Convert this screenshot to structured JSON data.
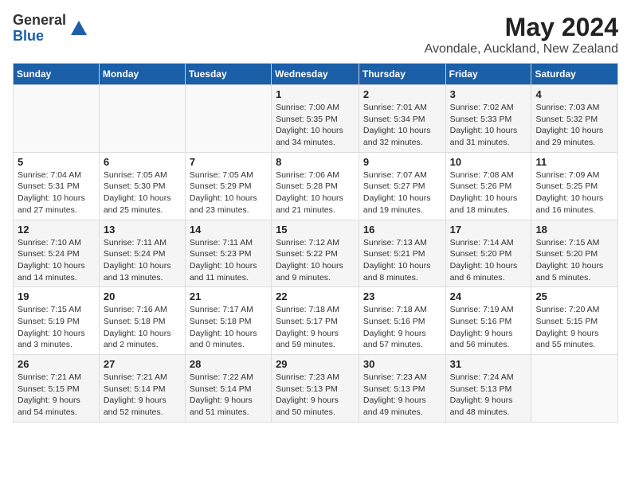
{
  "header": {
    "logo_general": "General",
    "logo_blue": "Blue",
    "month_year": "May 2024",
    "location": "Avondale, Auckland, New Zealand"
  },
  "days_of_week": [
    "Sunday",
    "Monday",
    "Tuesday",
    "Wednesday",
    "Thursday",
    "Friday",
    "Saturday"
  ],
  "weeks": [
    [
      {
        "day": "",
        "info": ""
      },
      {
        "day": "",
        "info": ""
      },
      {
        "day": "",
        "info": ""
      },
      {
        "day": "1",
        "info": "Sunrise: 7:00 AM\nSunset: 5:35 PM\nDaylight: 10 hours\nand 34 minutes."
      },
      {
        "day": "2",
        "info": "Sunrise: 7:01 AM\nSunset: 5:34 PM\nDaylight: 10 hours\nand 32 minutes."
      },
      {
        "day": "3",
        "info": "Sunrise: 7:02 AM\nSunset: 5:33 PM\nDaylight: 10 hours\nand 31 minutes."
      },
      {
        "day": "4",
        "info": "Sunrise: 7:03 AM\nSunset: 5:32 PM\nDaylight: 10 hours\nand 29 minutes."
      }
    ],
    [
      {
        "day": "5",
        "info": "Sunrise: 7:04 AM\nSunset: 5:31 PM\nDaylight: 10 hours\nand 27 minutes."
      },
      {
        "day": "6",
        "info": "Sunrise: 7:05 AM\nSunset: 5:30 PM\nDaylight: 10 hours\nand 25 minutes."
      },
      {
        "day": "7",
        "info": "Sunrise: 7:05 AM\nSunset: 5:29 PM\nDaylight: 10 hours\nand 23 minutes."
      },
      {
        "day": "8",
        "info": "Sunrise: 7:06 AM\nSunset: 5:28 PM\nDaylight: 10 hours\nand 21 minutes."
      },
      {
        "day": "9",
        "info": "Sunrise: 7:07 AM\nSunset: 5:27 PM\nDaylight: 10 hours\nand 19 minutes."
      },
      {
        "day": "10",
        "info": "Sunrise: 7:08 AM\nSunset: 5:26 PM\nDaylight: 10 hours\nand 18 minutes."
      },
      {
        "day": "11",
        "info": "Sunrise: 7:09 AM\nSunset: 5:25 PM\nDaylight: 10 hours\nand 16 minutes."
      }
    ],
    [
      {
        "day": "12",
        "info": "Sunrise: 7:10 AM\nSunset: 5:24 PM\nDaylight: 10 hours\nand 14 minutes."
      },
      {
        "day": "13",
        "info": "Sunrise: 7:11 AM\nSunset: 5:24 PM\nDaylight: 10 hours\nand 13 minutes."
      },
      {
        "day": "14",
        "info": "Sunrise: 7:11 AM\nSunset: 5:23 PM\nDaylight: 10 hours\nand 11 minutes."
      },
      {
        "day": "15",
        "info": "Sunrise: 7:12 AM\nSunset: 5:22 PM\nDaylight: 10 hours\nand 9 minutes."
      },
      {
        "day": "16",
        "info": "Sunrise: 7:13 AM\nSunset: 5:21 PM\nDaylight: 10 hours\nand 8 minutes."
      },
      {
        "day": "17",
        "info": "Sunrise: 7:14 AM\nSunset: 5:20 PM\nDaylight: 10 hours\nand 6 minutes."
      },
      {
        "day": "18",
        "info": "Sunrise: 7:15 AM\nSunset: 5:20 PM\nDaylight: 10 hours\nand 5 minutes."
      }
    ],
    [
      {
        "day": "19",
        "info": "Sunrise: 7:15 AM\nSunset: 5:19 PM\nDaylight: 10 hours\nand 3 minutes."
      },
      {
        "day": "20",
        "info": "Sunrise: 7:16 AM\nSunset: 5:18 PM\nDaylight: 10 hours\nand 2 minutes."
      },
      {
        "day": "21",
        "info": "Sunrise: 7:17 AM\nSunset: 5:18 PM\nDaylight: 10 hours\nand 0 minutes."
      },
      {
        "day": "22",
        "info": "Sunrise: 7:18 AM\nSunset: 5:17 PM\nDaylight: 9 hours\nand 59 minutes."
      },
      {
        "day": "23",
        "info": "Sunrise: 7:18 AM\nSunset: 5:16 PM\nDaylight: 9 hours\nand 57 minutes."
      },
      {
        "day": "24",
        "info": "Sunrise: 7:19 AM\nSunset: 5:16 PM\nDaylight: 9 hours\nand 56 minutes."
      },
      {
        "day": "25",
        "info": "Sunrise: 7:20 AM\nSunset: 5:15 PM\nDaylight: 9 hours\nand 55 minutes."
      }
    ],
    [
      {
        "day": "26",
        "info": "Sunrise: 7:21 AM\nSunset: 5:15 PM\nDaylight: 9 hours\nand 54 minutes."
      },
      {
        "day": "27",
        "info": "Sunrise: 7:21 AM\nSunset: 5:14 PM\nDaylight: 9 hours\nand 52 minutes."
      },
      {
        "day": "28",
        "info": "Sunrise: 7:22 AM\nSunset: 5:14 PM\nDaylight: 9 hours\nand 51 minutes."
      },
      {
        "day": "29",
        "info": "Sunrise: 7:23 AM\nSunset: 5:13 PM\nDaylight: 9 hours\nand 50 minutes."
      },
      {
        "day": "30",
        "info": "Sunrise: 7:23 AM\nSunset: 5:13 PM\nDaylight: 9 hours\nand 49 minutes."
      },
      {
        "day": "31",
        "info": "Sunrise: 7:24 AM\nSunset: 5:13 PM\nDaylight: 9 hours\nand 48 minutes."
      },
      {
        "day": "",
        "info": ""
      }
    ]
  ]
}
